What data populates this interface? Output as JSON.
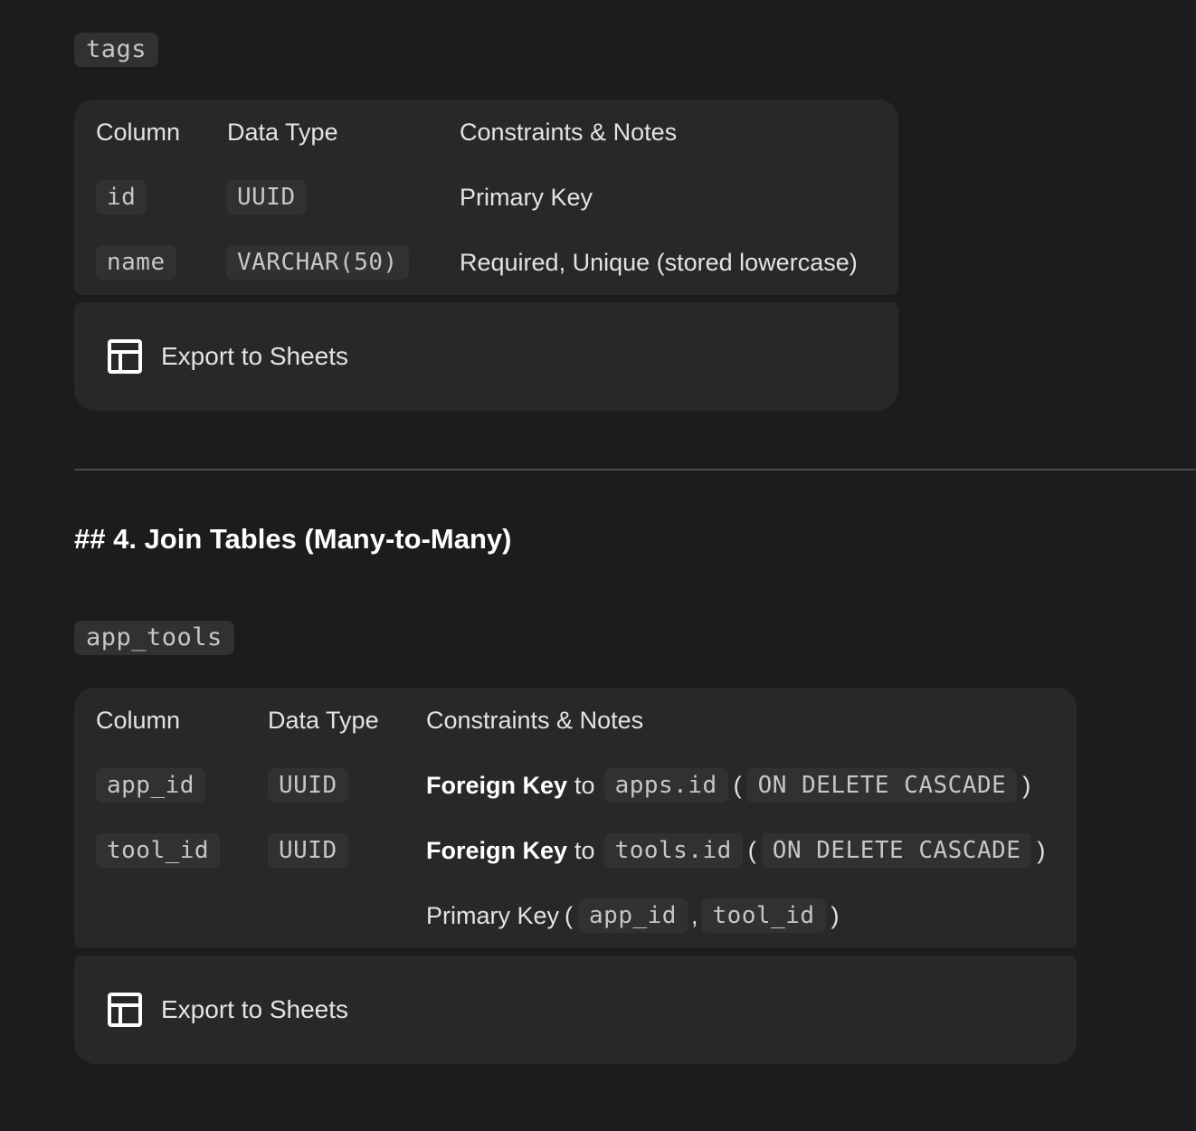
{
  "tags_section": {
    "label": "tags",
    "headers": {
      "column": "Column",
      "type": "Data Type",
      "notes": "Constraints & Notes"
    },
    "rows": [
      {
        "column": "id",
        "type": "UUID",
        "notes": "Primary Key"
      },
      {
        "column": "name",
        "type": "VARCHAR(50)",
        "notes": "Required, Unique (stored lowercase)"
      }
    ],
    "export_label": "Export to Sheets"
  },
  "heading": "## 4. Join Tables (Many-to-Many)",
  "app_tools_section": {
    "label": "app_tools",
    "headers": {
      "column": "Column",
      "type": "Data Type",
      "notes": "Constraints & Notes"
    },
    "rows": [
      {
        "column": "app_id",
        "type": "UUID",
        "notes": {
          "strong": "Foreign Key",
          "to": "to",
          "ref": "apps.id",
          "open": "(",
          "action": "ON DELETE CASCADE",
          "close": ")"
        }
      },
      {
        "column": "tool_id",
        "type": "UUID",
        "notes": {
          "strong": "Foreign Key",
          "to": "to",
          "ref": "tools.id",
          "open": "(",
          "action": "ON DELETE CASCADE",
          "close": ")"
        }
      },
      {
        "column": "",
        "type": "",
        "notes": {
          "text": "Primary Key",
          "open": "(",
          "col1": "app_id",
          "sep": ",",
          "col2": "tool_id",
          "close": ")"
        }
      }
    ],
    "export_label": "Export to Sheets"
  },
  "icons": {
    "export": "table-icon"
  }
}
